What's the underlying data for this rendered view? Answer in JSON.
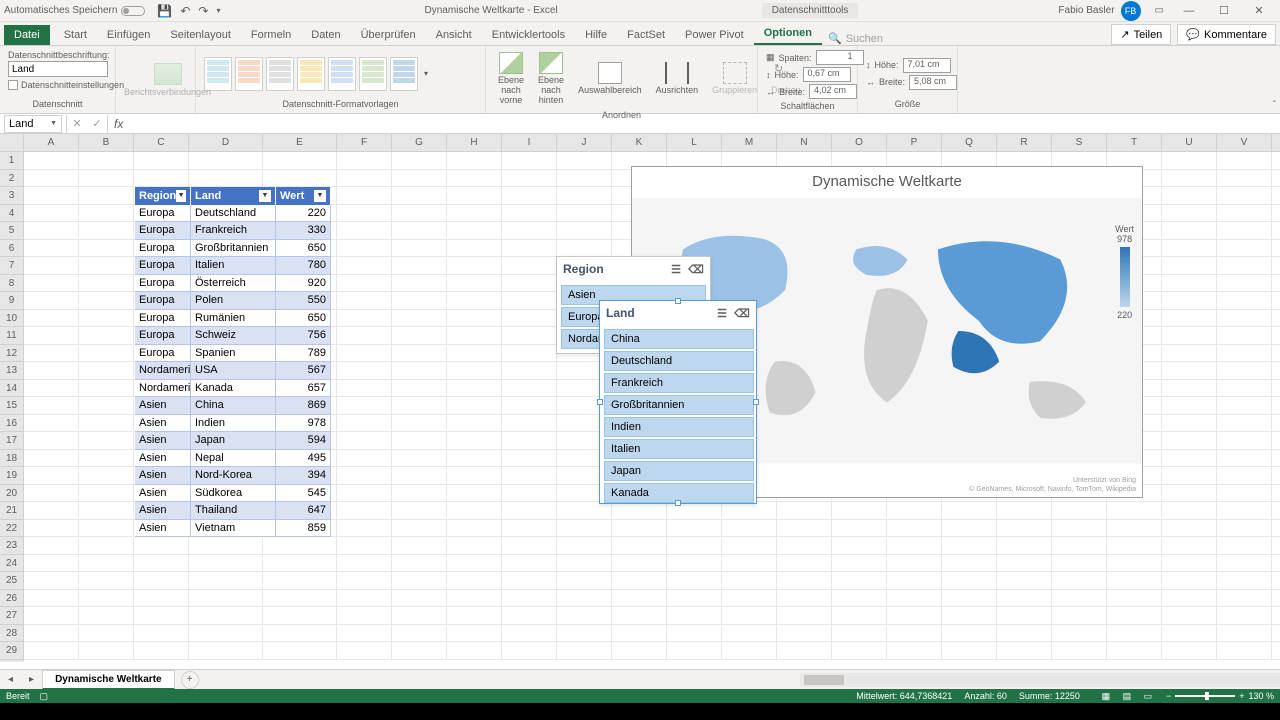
{
  "titlebar": {
    "autosave": "Automatisches Speichern",
    "doc_title": "Dynamische Weltkarte - Excel",
    "context_tab": "Datenschnitttools",
    "user_name": "Fabio Basler",
    "user_initials": "FB"
  },
  "ribbon_tabs": [
    "Datei",
    "Start",
    "Einfügen",
    "Seitenlayout",
    "Formeln",
    "Daten",
    "Überprüfen",
    "Ansicht",
    "Entwicklertools",
    "Hilfe",
    "FactSet",
    "Power Pivot",
    "Optionen"
  ],
  "ribbon_active": 12,
  "ribbon_search": "Suchen",
  "ribbon_share": "Teilen",
  "ribbon_comments": "Kommentare",
  "ribbon": {
    "caption_label": "Datenschnittbeschriftung:",
    "caption_value": "Land",
    "settings_label": "Datenschnitteinstellungen",
    "berichts": "Berichtsverbindungen",
    "grp_slicer": "Datenschnitt",
    "grp_styles": "Datenschnitt-Formatvorlagen",
    "fwd_lbl": "Ebene nach vorne",
    "back_lbl": "Ebene nach hinten",
    "selpane": "Auswahlbereich",
    "align": "Ausrichten",
    "group": "Gruppieren",
    "rotate": "Drehen",
    "grp_arrange": "Anordnen",
    "cols_lbl": "Spalten:",
    "cols_val": "1",
    "btn_h_lbl": "Höhe:",
    "btn_h_val": "0,67 cm",
    "btn_w_lbl": "Breite:",
    "btn_w_val": "4,02 cm",
    "grp_buttons": "Schaltflächen",
    "size_h_lbl": "Höhe:",
    "size_h_val": "7,01 cm",
    "size_w_lbl": "Breite:",
    "size_w_val": "5,08 cm",
    "grp_size": "Größe"
  },
  "namebox": "Land",
  "columns": [
    "A",
    "B",
    "C",
    "D",
    "E",
    "F",
    "G",
    "H",
    "I",
    "J",
    "K",
    "L",
    "M",
    "N",
    "O",
    "P",
    "Q",
    "R",
    "S",
    "T",
    "U",
    "V"
  ],
  "rows_count": 29,
  "table": {
    "headers": [
      "Region",
      "Land",
      "Wert"
    ],
    "rows": [
      [
        "Europa",
        "Deutschland",
        "220"
      ],
      [
        "Europa",
        "Frankreich",
        "330"
      ],
      [
        "Europa",
        "Großbritannien",
        "650"
      ],
      [
        "Europa",
        "Italien",
        "780"
      ],
      [
        "Europa",
        "Österreich",
        "920"
      ],
      [
        "Europa",
        "Polen",
        "550"
      ],
      [
        "Europa",
        "Rumänien",
        "650"
      ],
      [
        "Europa",
        "Schweiz",
        "756"
      ],
      [
        "Europa",
        "Spanien",
        "789"
      ],
      [
        "Nordamerika",
        "USA",
        "567"
      ],
      [
        "Nordamerika",
        "Kanada",
        "657"
      ],
      [
        "Asien",
        "China",
        "869"
      ],
      [
        "Asien",
        "Indien",
        "978"
      ],
      [
        "Asien",
        "Japan",
        "594"
      ],
      [
        "Asien",
        "Nepal",
        "495"
      ],
      [
        "Asien",
        "Nord-Korea",
        "394"
      ],
      [
        "Asien",
        "Südkorea",
        "545"
      ],
      [
        "Asien",
        "Thailand",
        "647"
      ],
      [
        "Asien",
        "Vietnam",
        "859"
      ]
    ]
  },
  "chart": {
    "title": "Dynamische Weltkarte",
    "legend_label": "Wert",
    "legend_max": "978",
    "legend_min": "220",
    "credit1": "Unterstützt von Bing",
    "credit2": "© GeoNames, Microsoft, Navinfo, TomTom, Wikipedia"
  },
  "slicer_region": {
    "title": "Region",
    "items": [
      "Asien",
      "Europa",
      "Nordamerika"
    ]
  },
  "slicer_land": {
    "title": "Land",
    "items": [
      "China",
      "Deutschland",
      "Frankreich",
      "Großbritannien",
      "Indien",
      "Italien",
      "Japan",
      "Kanada"
    ]
  },
  "sheet_tab": "Dynamische Weltkarte",
  "status": {
    "ready": "Bereit",
    "avg_lbl": "Mittelwert:",
    "avg_val": "644,7368421",
    "count_lbl": "Anzahl:",
    "count_val": "60",
    "sum_lbl": "Summe:",
    "sum_val": "12250",
    "zoom": "130 %"
  },
  "chart_data": {
    "type": "map",
    "title": "Dynamische Weltkarte",
    "value_label": "Wert",
    "color_scale": {
      "min": 220,
      "max": 978,
      "min_color": "#bdd7ee",
      "max_color": "#2e75b6"
    },
    "series": [
      {
        "country": "Deutschland",
        "value": 220
      },
      {
        "country": "Frankreich",
        "value": 330
      },
      {
        "country": "Großbritannien",
        "value": 650
      },
      {
        "country": "Italien",
        "value": 780
      },
      {
        "country": "Österreich",
        "value": 920
      },
      {
        "country": "Polen",
        "value": 550
      },
      {
        "country": "Rumänien",
        "value": 650
      },
      {
        "country": "Schweiz",
        "value": 756
      },
      {
        "country": "Spanien",
        "value": 789
      },
      {
        "country": "USA",
        "value": 567
      },
      {
        "country": "Kanada",
        "value": 657
      },
      {
        "country": "China",
        "value": 869
      },
      {
        "country": "Indien",
        "value": 978
      },
      {
        "country": "Japan",
        "value": 594
      },
      {
        "country": "Nepal",
        "value": 495
      },
      {
        "country": "Nord-Korea",
        "value": 394
      },
      {
        "country": "Südkorea",
        "value": 545
      },
      {
        "country": "Thailand",
        "value": 647
      },
      {
        "country": "Vietnam",
        "value": 859
      }
    ]
  }
}
